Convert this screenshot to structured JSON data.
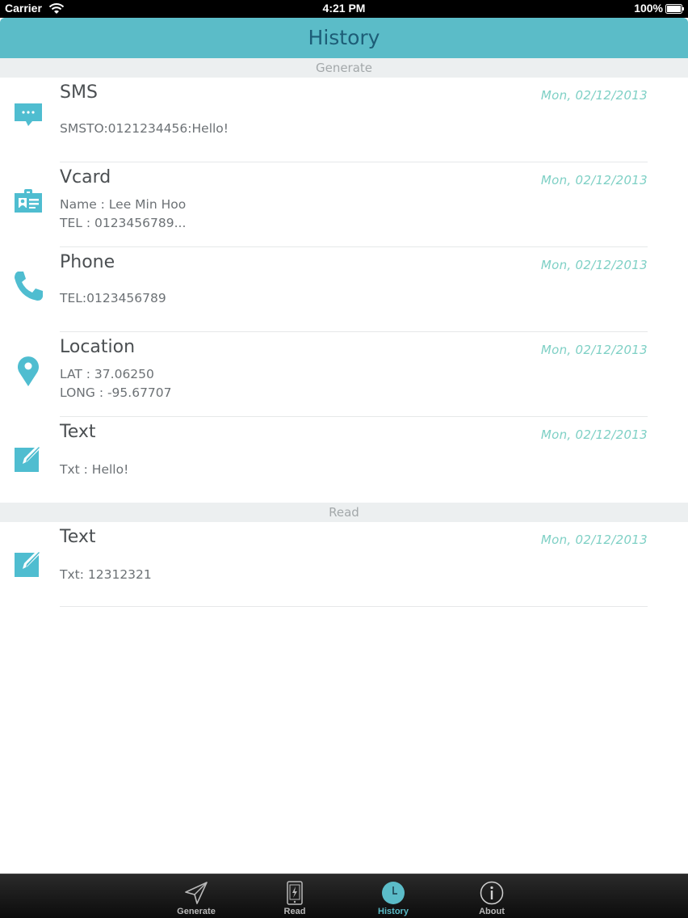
{
  "status_bar": {
    "carrier": "Carrier",
    "time": "4:21 PM",
    "battery": "100%"
  },
  "nav": {
    "title": "History"
  },
  "sections": [
    {
      "header": "Generate",
      "items": [
        {
          "icon": "sms-icon",
          "title": "SMS",
          "date": "Mon, 02/12/2013",
          "line1": "",
          "line2": "SMSTO:0121234456:Hello!"
        },
        {
          "icon": "vcard-icon",
          "title": "Vcard",
          "date": "Mon, 02/12/2013",
          "line1": "Name : Lee Min Hoo",
          "line2": "TEL : 0123456789..."
        },
        {
          "icon": "phone-icon",
          "title": "Phone",
          "date": "Mon, 02/12/2013",
          "line1": "",
          "line2": "TEL:0123456789"
        },
        {
          "icon": "location-pin-icon",
          "title": "Location",
          "date": "Mon, 02/12/2013",
          "line1": "LAT : 37.06250",
          "line2": "LONG : -95.67707"
        },
        {
          "icon": "edit-text-icon",
          "title": "Text",
          "date": "Mon, 02/12/2013",
          "line1": "",
          "line2": "Txt : Hello!"
        }
      ]
    },
    {
      "header": "Read",
      "items": [
        {
          "icon": "edit-text-icon",
          "title": "Text",
          "date": "Mon, 02/12/2013",
          "line1": "",
          "line2": "Txt: 12312321"
        }
      ]
    }
  ],
  "tabs": [
    {
      "label": "Generate",
      "icon": "send-icon",
      "active": false
    },
    {
      "label": "Read",
      "icon": "phone-scan-icon",
      "active": false
    },
    {
      "label": "History",
      "icon": "clock-icon",
      "active": true
    },
    {
      "label": "About",
      "icon": "info-icon",
      "active": false
    }
  ],
  "colors": {
    "accent": "#5bbcc8",
    "nav_title": "#1d5d77",
    "date": "#7ed0c5"
  }
}
